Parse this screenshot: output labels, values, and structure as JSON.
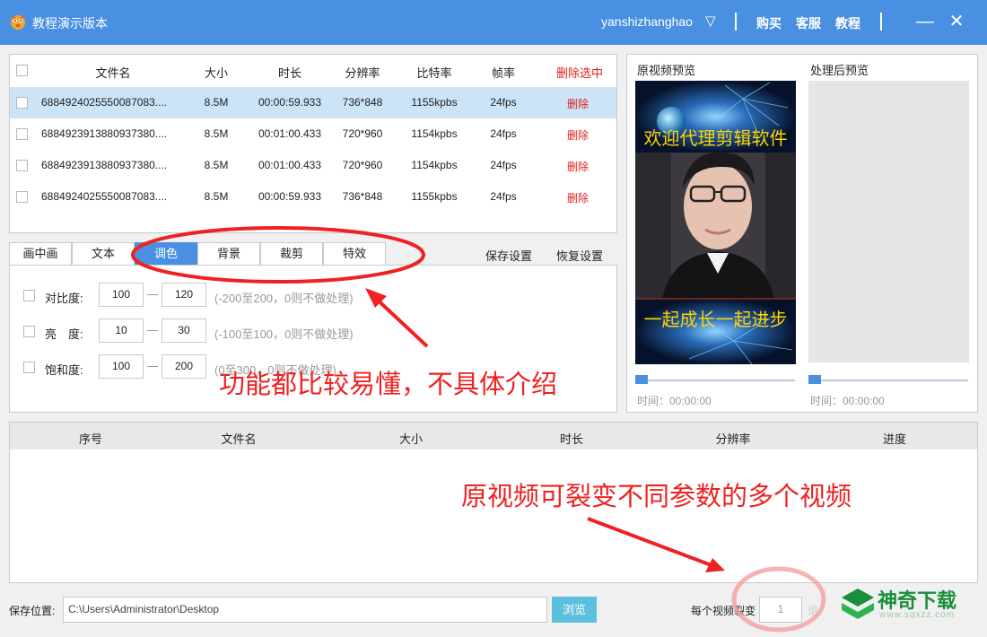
{
  "titlebar": {
    "app_title": "教程演示版本",
    "user": "yanshizhanghao",
    "caret": "▽",
    "links": [
      "购买",
      "客服",
      "教程"
    ],
    "minimize": "—",
    "close": "✕"
  },
  "file_table": {
    "headers": {
      "name": "文件名",
      "size": "大小",
      "duration": "时长",
      "resolution": "分辨率",
      "bitrate": "比特率",
      "fps": "帧率",
      "delete_selected": "删除选中"
    },
    "rows": [
      {
        "name": "6884924025550087083....",
        "size": "8.5M",
        "duration": "00:00:59.933",
        "resolution": "736*848",
        "bitrate": "1155kpbs",
        "fps": "24fps",
        "delete": "删除",
        "selected": true
      },
      {
        "name": "6884923913880937380....",
        "size": "8.5M",
        "duration": "00:01:00.433",
        "resolution": "720*960",
        "bitrate": "1154kpbs",
        "fps": "24fps",
        "delete": "删除",
        "selected": false
      },
      {
        "name": "6884923913880937380....",
        "size": "8.5M",
        "duration": "00:01:00.433",
        "resolution": "720*960",
        "bitrate": "1154kpbs",
        "fps": "24fps",
        "delete": "删除",
        "selected": false
      },
      {
        "name": "6884924025550087083....",
        "size": "8.5M",
        "duration": "00:00:59.933",
        "resolution": "736*848",
        "bitrate": "1155kpbs",
        "fps": "24fps",
        "delete": "删除",
        "selected": false
      }
    ]
  },
  "tabs": {
    "items": [
      "画中画",
      "文本",
      "调色",
      "背景",
      "裁剪",
      "特效"
    ],
    "active": "调色",
    "save_settings": "保存设置",
    "restore_settings": "恢复设置"
  },
  "adjust": {
    "rows": [
      {
        "label": "对比度:",
        "min": "100",
        "max": "120",
        "hint": "(-200至200，0则不做处理)"
      },
      {
        "label": "亮　度:",
        "min": "10",
        "max": "30",
        "hint": "(-100至100，0则不做处理)"
      },
      {
        "label": "饱和度:",
        "min": "100",
        "max": "200",
        "hint": "(0至300，0则不做处理)"
      }
    ]
  },
  "preview": {
    "original_label": "原视频预览",
    "processed_label": "处理后预览",
    "caption_top": "欢迎代理剪辑软件",
    "caption_bottom": "一起成长一起进步",
    "time_original": "时间：00:00:00",
    "time_processed": "时间：00:00:00",
    "progress_original": 0,
    "progress_processed": 0
  },
  "output_table": {
    "headers": {
      "index": "序号",
      "name": "文件名",
      "size": "大小",
      "duration": "时长",
      "resolution": "分辨率",
      "progress": "进度"
    }
  },
  "bottom": {
    "save_label": "保存位置:",
    "save_path": "C:\\Users\\Administrator\\Desktop",
    "browse": "浏览",
    "split_label": "每个视频裂变",
    "split_value": "1",
    "split_unit_faded": "退"
  },
  "annotations": {
    "text1": "功能都比较易懂，不具体介绍",
    "text2": "原视频可裂变不同参数的多个视频"
  },
  "watermark": {
    "text": "神奇下载",
    "url": "www.sqxzz.com"
  },
  "colors": {
    "titlebar": "#4a90e2",
    "accent": "#4a90e2",
    "delete": "#e02020",
    "annotation": "#ee2222",
    "selected_row": "#cce4f7",
    "browse": "#5bc0de"
  }
}
